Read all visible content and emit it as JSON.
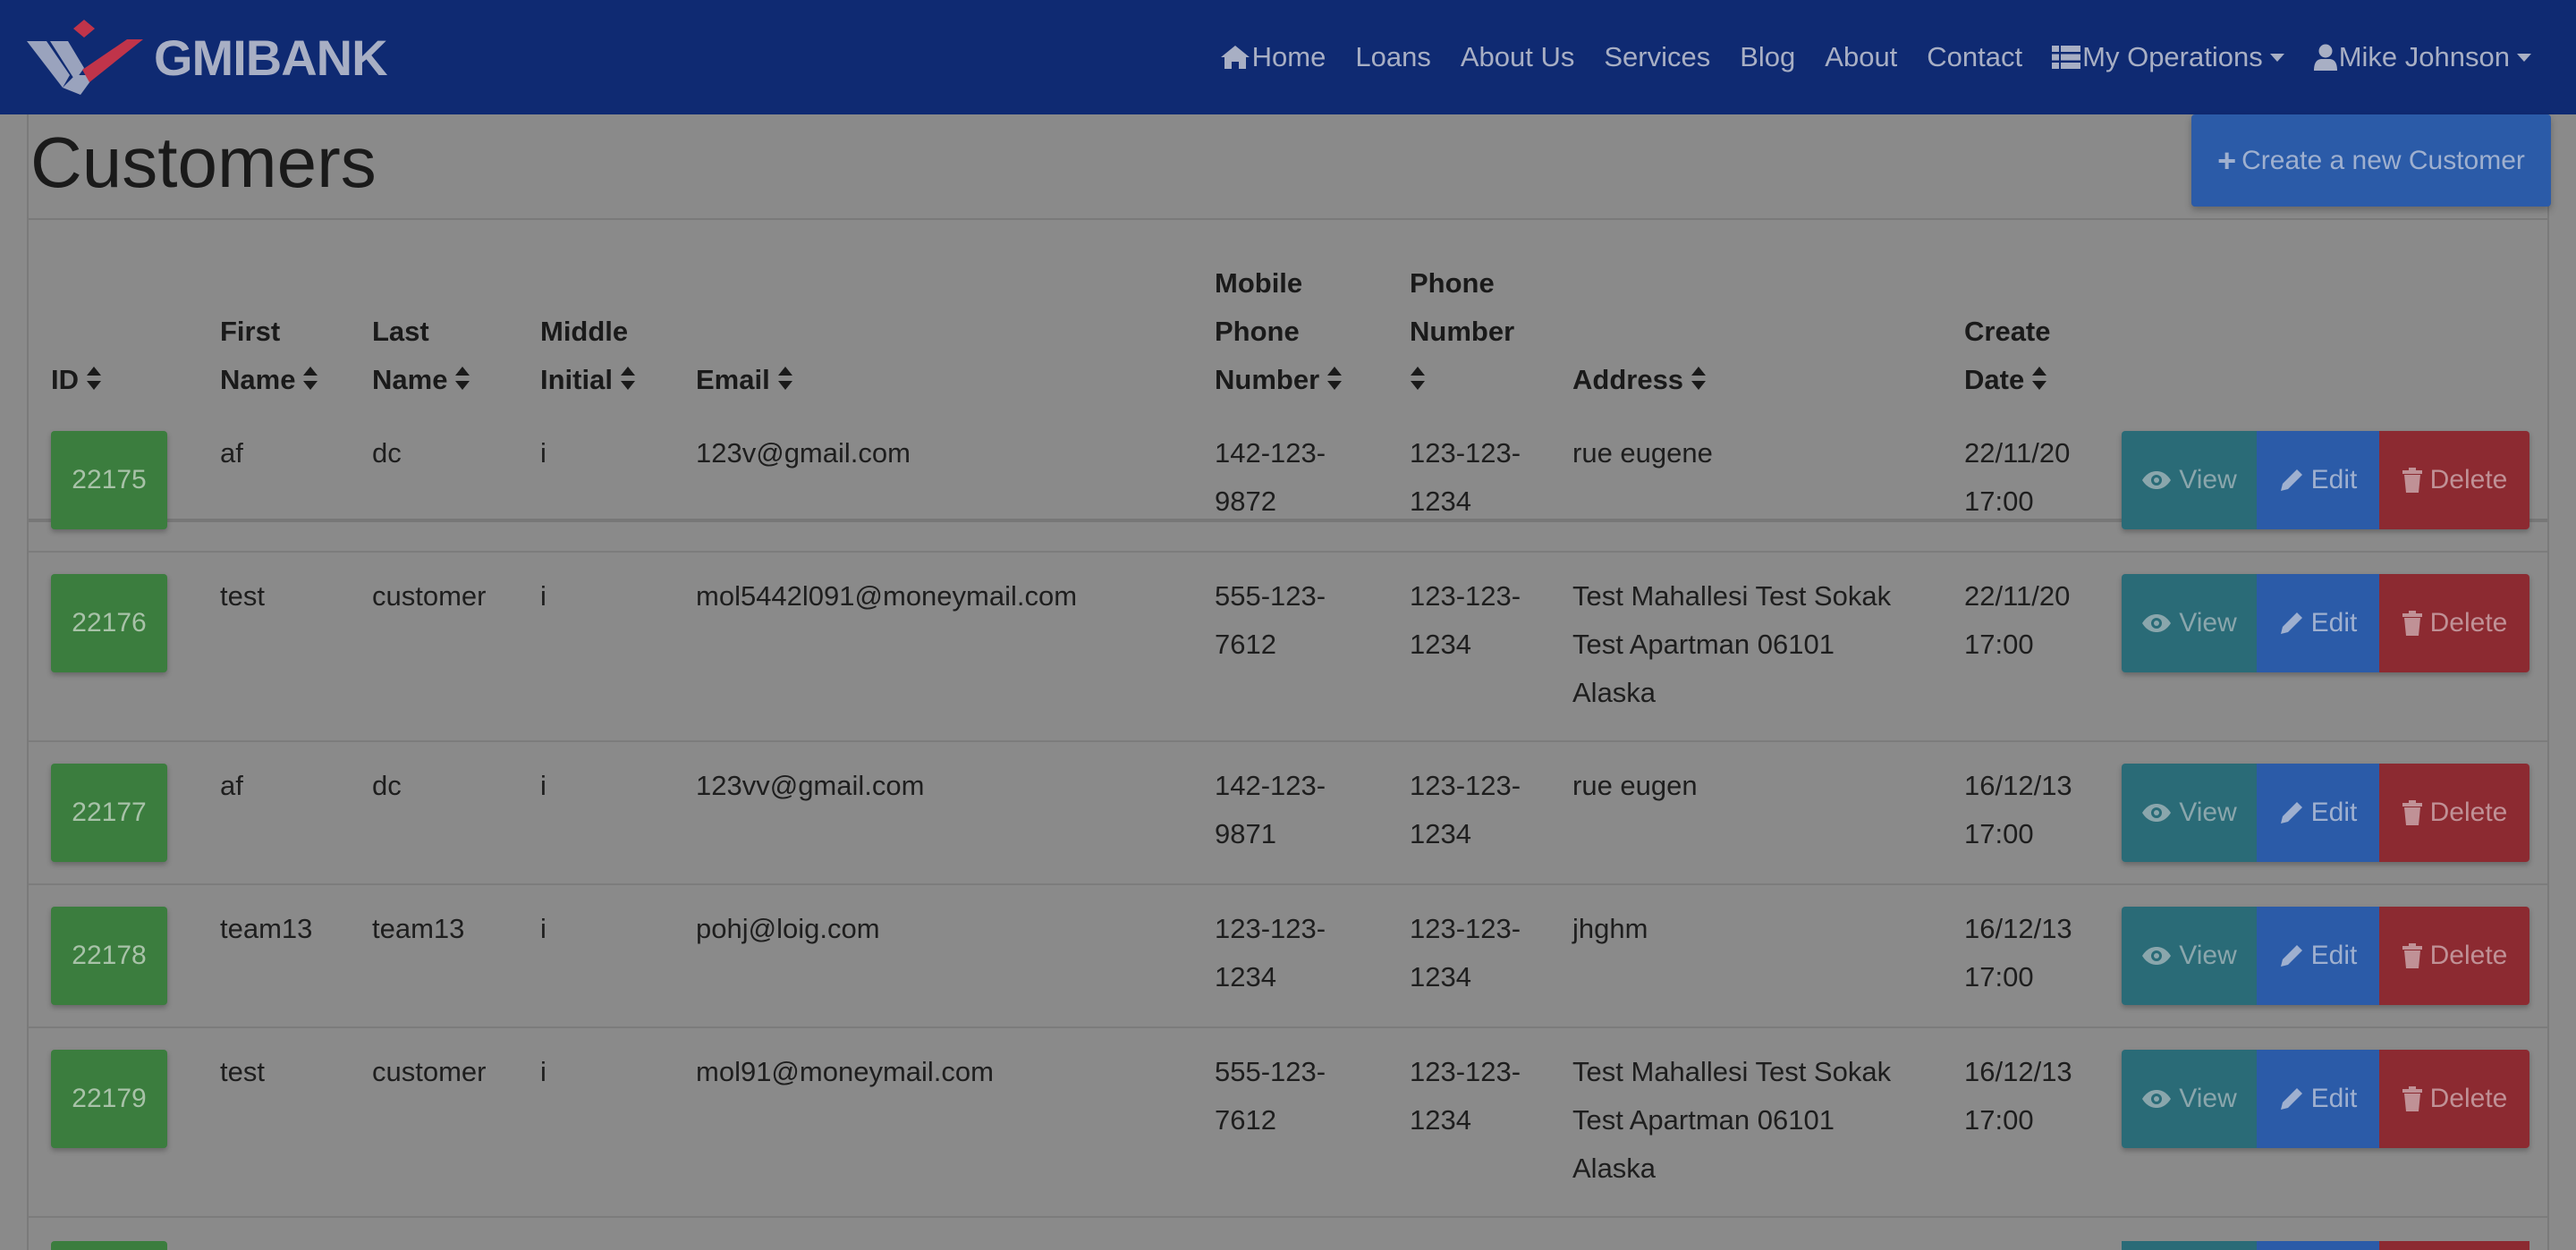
{
  "colors": {
    "navbar": "#0f2a72",
    "overlay_bg": "#8a8a8a",
    "id_badge": "#3b7d3e",
    "view": "#2a6b77",
    "edit": "#2b5ba8",
    "delete": "#8c2a31"
  },
  "brand": {
    "name": "GMIBANK",
    "logo": "gmibank-logo"
  },
  "nav": {
    "home": "Home",
    "loans": "Loans",
    "about_us": "About Us",
    "services": "Services",
    "blog": "Blog",
    "about": "About",
    "contact": "Contact",
    "my_operations": "My Operations",
    "user": "Mike Johnson"
  },
  "page": {
    "title": "Customers",
    "create_label": "Create a new Customer"
  },
  "table": {
    "headers": {
      "id": "ID",
      "first_name": [
        "First",
        "Name"
      ],
      "last_name": [
        "Last",
        "Name"
      ],
      "middle_initial": [
        "Middle",
        "Initial"
      ],
      "email": "Email",
      "mobile": [
        "Mobile",
        "Phone",
        "Number"
      ],
      "phone": [
        "Phone",
        "Number"
      ],
      "address": "Address",
      "create_date": [
        "Create",
        "Date"
      ]
    },
    "actions": {
      "view": "View",
      "edit": "Edit",
      "delete": "Delete"
    },
    "rows": [
      {
        "id": "22175",
        "first": "af",
        "last": "dc",
        "middle": "i",
        "email": "123v@gmail.com",
        "mobile": [
          "142-123-",
          "9872"
        ],
        "phone": [
          "123-123-",
          "1234"
        ],
        "address": [
          "rue eugene"
        ],
        "date": [
          "22/11/20",
          "17:00"
        ]
      },
      {
        "id": "22176",
        "first": "test",
        "last": "customer",
        "middle": "i",
        "email": "mol5442l091@moneymail.com",
        "mobile": [
          "555-123-",
          "7612"
        ],
        "phone": [
          "123-123-",
          "1234"
        ],
        "address": [
          "Test Mahallesi Test Sokak",
          "Test Apartman 06101",
          "Alaska"
        ],
        "date": [
          "22/11/20",
          "17:00"
        ]
      },
      {
        "id": "22177",
        "first": "af",
        "last": "dc",
        "middle": "i",
        "email": "123vv@gmail.com",
        "mobile": [
          "142-123-",
          "9871"
        ],
        "phone": [
          "123-123-",
          "1234"
        ],
        "address": [
          "rue eugen"
        ],
        "date": [
          "16/12/13",
          "17:00"
        ]
      },
      {
        "id": "22178",
        "first": "team13",
        "last": "team13",
        "middle": "i",
        "email": "pohj@loig.com",
        "mobile": [
          "123-123-",
          "1234"
        ],
        "phone": [
          "123-123-",
          "1234"
        ],
        "address": [
          "jhghm"
        ],
        "date": [
          "16/12/13",
          "17:00"
        ]
      },
      {
        "id": "22179",
        "first": "test",
        "last": "customer",
        "middle": "i",
        "email": "mol91@moneymail.com",
        "mobile": [
          "555-123-",
          "7612"
        ],
        "phone": [
          "123-123-",
          "1234"
        ],
        "address": [
          "Test Mahallesi Test Sokak",
          "Test Apartman 06101",
          "Alaska"
        ],
        "date": [
          "16/12/13",
          "17:00"
        ]
      }
    ]
  }
}
